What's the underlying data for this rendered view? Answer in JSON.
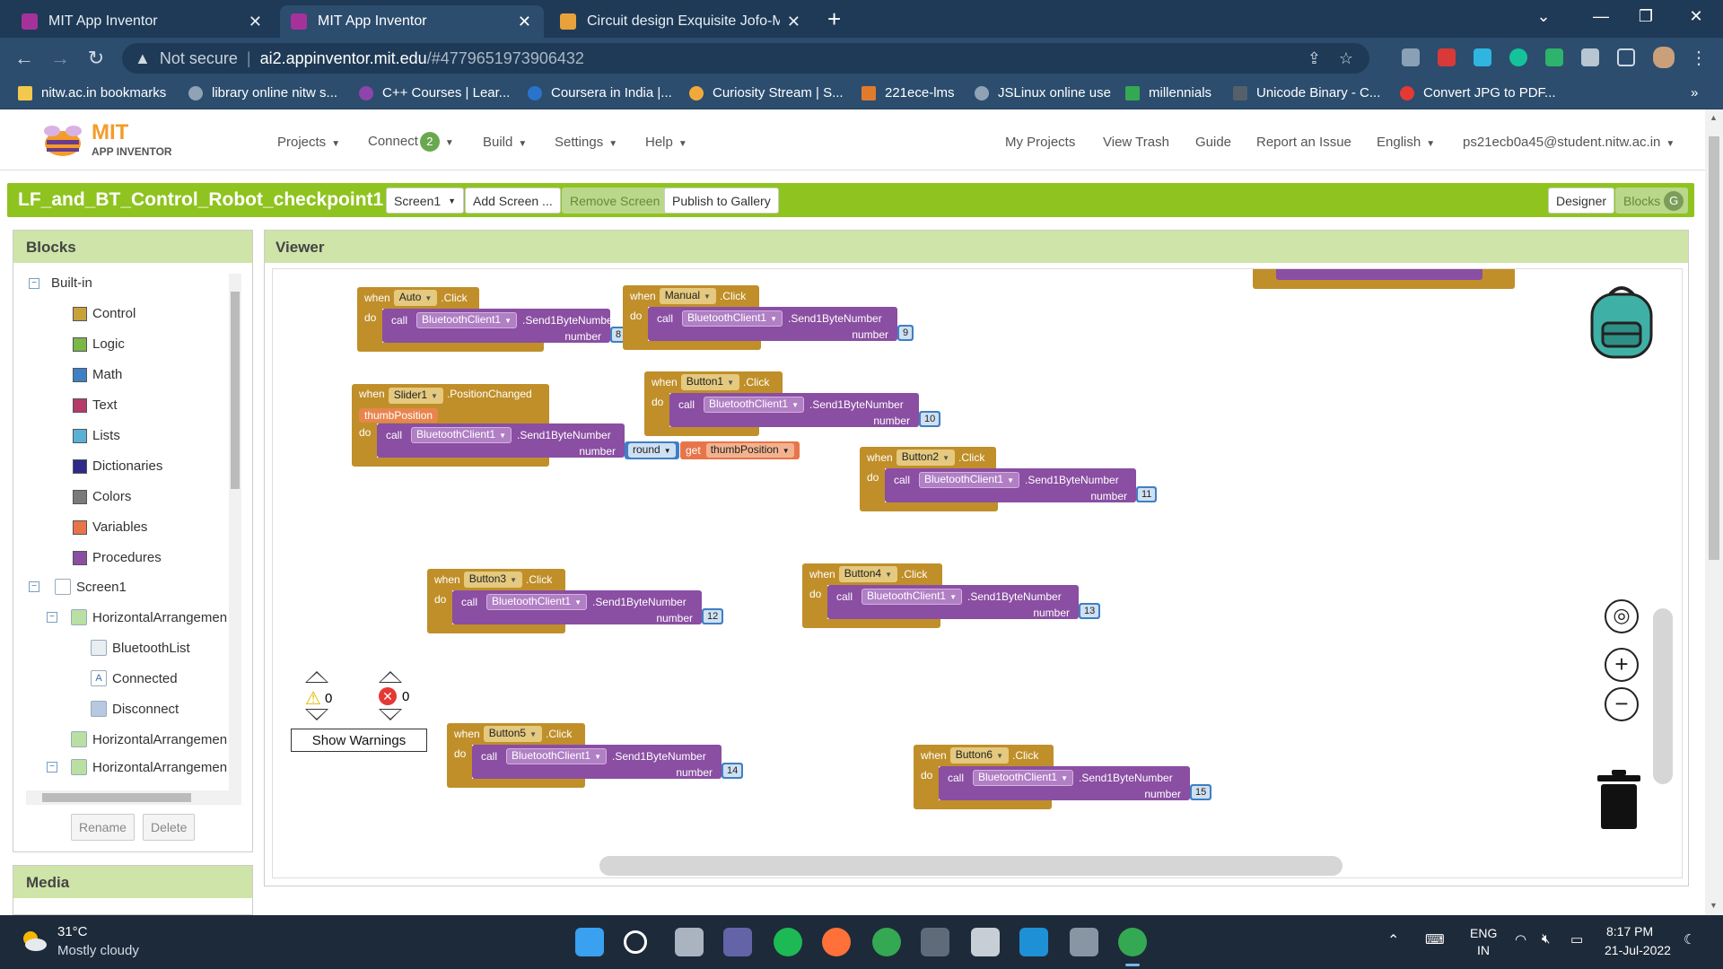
{
  "browser": {
    "tabs": [
      {
        "title": "MIT App Inventor",
        "active": false
      },
      {
        "title": "MIT App Inventor",
        "active": true
      },
      {
        "title": "Circuit design Exquisite Jofo-Mig",
        "active": false
      }
    ],
    "new_tab": "+",
    "address": {
      "security": "Not secure",
      "separator": "|",
      "host": "ai2.appinventor.mit.edu",
      "path": "/#4779651973906432"
    },
    "bookmarks": [
      "nitw.ac.in bookmarks",
      "library online nitw s...",
      "C++ Courses | Lear...",
      "Coursera in India |...",
      "Curiosity Stream | S...",
      "221ece-lms",
      "JSLinux online use",
      "millennials",
      "Unicode Binary - C...",
      "Convert JPG to PDF..."
    ],
    "bookmarks_more": "»"
  },
  "header": {
    "logo_mit": "MIT",
    "logo_app": "APP INVENTOR",
    "menu_left": [
      "Projects",
      "Connect",
      "Build",
      "Settings",
      "Help"
    ],
    "connect_badge": "2",
    "menu_right": [
      "My Projects",
      "View Trash",
      "Guide",
      "Report an Issue",
      "English",
      "ps21ecb0a45@student.nitw.ac.in"
    ]
  },
  "project": {
    "title": "LF_and_BT_Control_Robot_checkpoint1",
    "screen_dropdown": "Screen1",
    "add_screen": "Add Screen ...",
    "remove_screen": "Remove Screen",
    "publish": "Publish to Gallery",
    "designer": "Designer",
    "blocks": "Blocks",
    "blocks_badge": "G"
  },
  "blocks_panel": {
    "title": "Blocks",
    "builtin_label": "Built-in",
    "builtin": [
      {
        "label": "Control",
        "color": "#c8a13a"
      },
      {
        "label": "Logic",
        "color": "#7ab648"
      },
      {
        "label": "Math",
        "color": "#3f7fc4"
      },
      {
        "label": "Text",
        "color": "#b63a6a"
      },
      {
        "label": "Lists",
        "color": "#5bb0d6"
      },
      {
        "label": "Dictionaries",
        "color": "#2d2a8a"
      },
      {
        "label": "Colors",
        "color": "#7a7a7a"
      },
      {
        "label": "Variables",
        "color": "#e8754a"
      },
      {
        "label": "Procedures",
        "color": "#8a4ea2"
      }
    ],
    "screen": "Screen1",
    "components": [
      "HorizontalArrangemen",
      "BluetoothList",
      "Connected",
      "Disconnect",
      "HorizontalArrangemen",
      "HorizontalArrangemen"
    ],
    "rename": "Rename",
    "delete": "Delete",
    "media_title": "Media"
  },
  "viewer": {
    "title": "Viewer",
    "blocks": [
      {
        "when": "when",
        "comp": "Auto",
        "event": ".Click",
        "do": "do",
        "call": "call",
        "target": "BluetoothClient1",
        "method": ".Send1ByteNumber",
        "arg": "number",
        "value": "8"
      },
      {
        "when": "when",
        "comp": "Manual",
        "event": ".Click",
        "do": "do",
        "call": "call",
        "target": "BluetoothClient1",
        "method": ".Send1ByteNumber",
        "arg": "number",
        "value": "9"
      },
      {
        "when": "when",
        "comp": "Button1",
        "event": ".Click",
        "do": "do",
        "call": "call",
        "target": "BluetoothClient1",
        "method": ".Send1ByteNumber",
        "arg": "number",
        "value": "10"
      },
      {
        "when": "when",
        "comp": "Button2",
        "event": ".Click",
        "do": "do",
        "call": "call",
        "target": "BluetoothClient1",
        "method": ".Send1ByteNumber",
        "arg": "number",
        "value": "11"
      },
      {
        "when": "when",
        "comp": "Button3",
        "event": ".Click",
        "do": "do",
        "call": "call",
        "target": "BluetoothClient1",
        "method": ".Send1ByteNumber",
        "arg": "number",
        "value": "12"
      },
      {
        "when": "when",
        "comp": "Button4",
        "event": ".Click",
        "do": "do",
        "call": "call",
        "target": "BluetoothClient1",
        "method": ".Send1ByteNumber",
        "arg": "number",
        "value": "13"
      },
      {
        "when": "when",
        "comp": "Button5",
        "event": ".Click",
        "do": "do",
        "call": "call",
        "target": "BluetoothClient1",
        "method": ".Send1ByteNumber",
        "arg": "number",
        "value": "14"
      },
      {
        "when": "when",
        "comp": "Button6",
        "event": ".Click",
        "do": "do",
        "call": "call",
        "target": "BluetoothClient1",
        "method": ".Send1ByteNumber",
        "arg": "number",
        "value": "15"
      }
    ],
    "slider_block": {
      "when": "when",
      "comp": "Slider1",
      "event": ".PositionChanged",
      "param": "thumbPosition",
      "do": "do",
      "call": "call",
      "target": "BluetoothClient1",
      "method": ".Send1ByteNumber",
      "arg": "number",
      "round": "round",
      "get": "get",
      "get_var": "thumbPosition"
    },
    "warnings_count": "0",
    "errors_count": "0",
    "show_warnings": "Show Warnings"
  },
  "taskbar": {
    "temp": "31°C",
    "weather": "Mostly cloudy",
    "lang1": "ENG",
    "lang2": "IN",
    "time": "8:17 PM",
    "date": "21-Jul-2022"
  }
}
